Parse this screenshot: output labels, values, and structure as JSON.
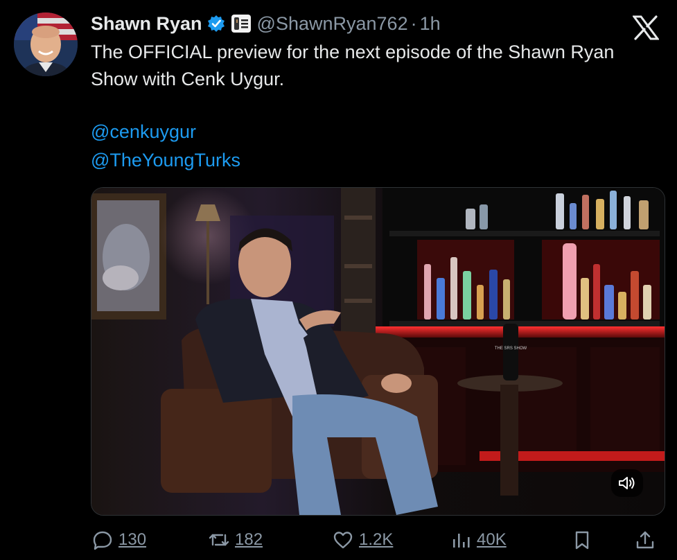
{
  "tweet": {
    "author_name": "Shawn Ryan",
    "handle": "@ShawnRyan762",
    "separator": "·",
    "time": "1h",
    "text": "The OFFICIAL preview for the next episode of the Shawn Ryan Show with Cenk Uygur.",
    "mentions": [
      "@cenkuygur",
      "@TheYoungTurks"
    ]
  },
  "icons": {
    "verified": "verified-badge-icon",
    "affiliation": "affiliate-badge-icon",
    "brand": "x-logo-icon",
    "sound": "volume-icon"
  },
  "media": {
    "bottle_label": "THE SRS SHOW"
  },
  "actions": {
    "replies": "130",
    "reposts": "182",
    "likes": "1.2K",
    "views": "40K"
  },
  "colors": {
    "background": "#000000",
    "link": "#1d9bf0",
    "muted": "#8b98a5",
    "text": "#e7e9ea"
  }
}
